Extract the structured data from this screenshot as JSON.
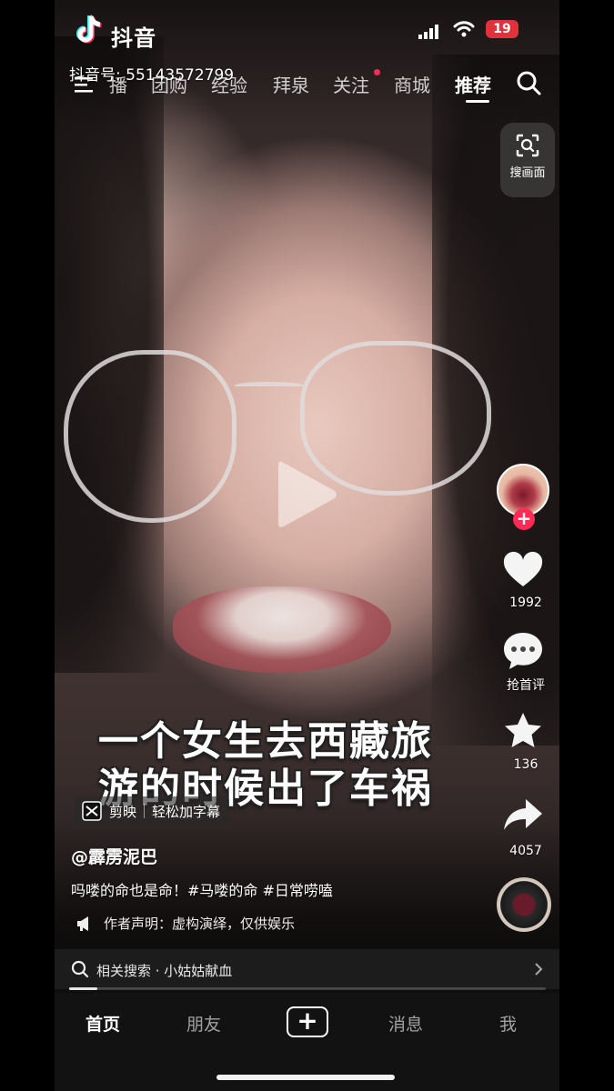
{
  "status_bar": {
    "app_name": "抖音",
    "battery": "19"
  },
  "watermark": {
    "id_text": "抖音号: 55143572799"
  },
  "nav": {
    "tabs": [
      {
        "label": "播"
      },
      {
        "label": "团购"
      },
      {
        "label": "经验"
      },
      {
        "label": "拜泉"
      },
      {
        "label": "关注",
        "has_dot": true
      },
      {
        "label": "商城"
      },
      {
        "label": "推荐",
        "active": true
      }
    ]
  },
  "image_search": {
    "label": "搜画面"
  },
  "right_rail": {
    "likes": "1992",
    "comments_label": "抢首评",
    "favorites": "136",
    "shares": "4057"
  },
  "video": {
    "subtitle_line1": "一个女生去西藏旅",
    "subtitle_line2": "游的时候出了车祸",
    "capcut_brand": "剪映",
    "capcut_slogan": "轻松加字幕",
    "author": "@霹雳泥巴",
    "caption": "吗喽的命也是命！#马喽的命 #日常唠嗑",
    "disclaimer": "作者声明：虚构演绎，仅供娱乐",
    "progress_percent": 6
  },
  "related_search": {
    "label": "相关搜索 · 小姑姑献血"
  },
  "bottom_tabs": {
    "home": "首页",
    "friends": "朋友",
    "create": "+",
    "messages": "消息",
    "me": "我"
  },
  "colors": {
    "accent": "#fe2c55",
    "battery": "#e0323c"
  }
}
